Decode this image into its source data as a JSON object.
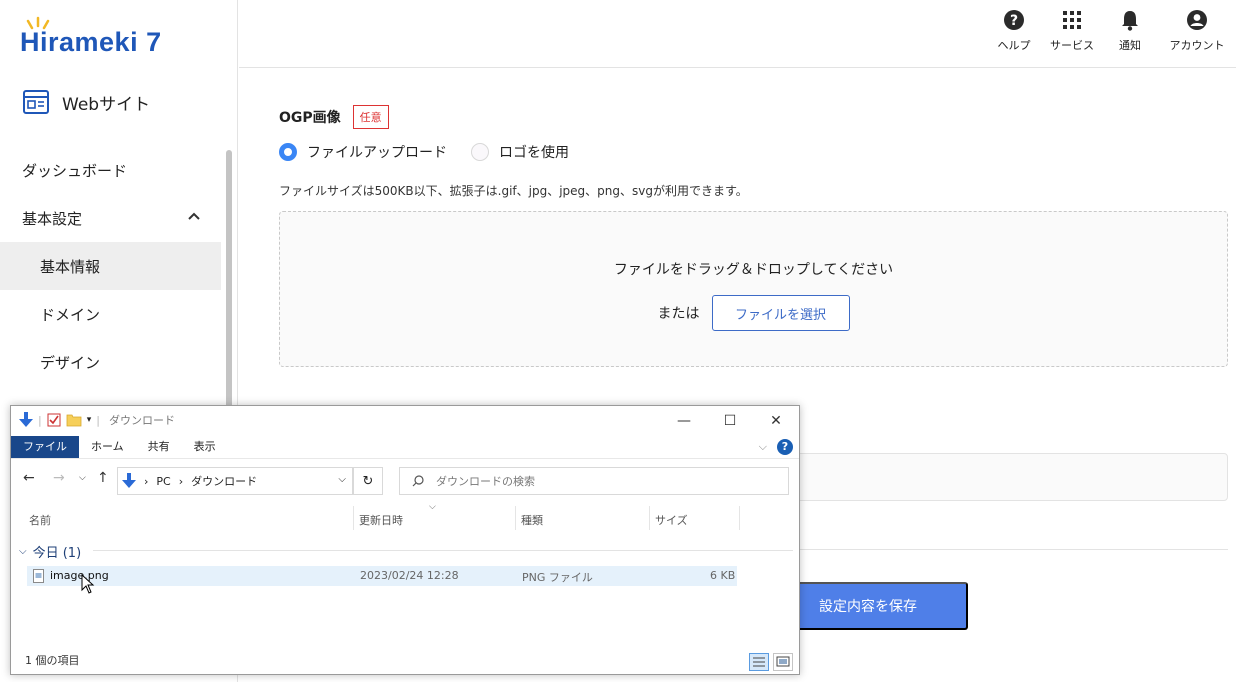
{
  "logo": {
    "text": "Hirameki 7"
  },
  "sidebar": {
    "site_label": "Webサイト",
    "items": [
      {
        "label": "ダッシュボード"
      },
      {
        "label": "基本設定"
      },
      {
        "label": "基本情報"
      },
      {
        "label": "ドメイン"
      },
      {
        "label": "デザイン"
      }
    ]
  },
  "header": {
    "actions": [
      {
        "label": "ヘルプ",
        "icon": "help-icon"
      },
      {
        "label": "サービス",
        "icon": "grid-icon"
      },
      {
        "label": "通知",
        "icon": "bell-icon"
      },
      {
        "label": "アカウント",
        "icon": "account-icon"
      }
    ]
  },
  "form": {
    "ogp_label": "OGP画像",
    "optional_badge": "任意",
    "radio_upload": "ファイルアップロード",
    "radio_logo": "ロゴを使用",
    "hint": "ファイルサイズは500KB以下、拡張子は.gif、jpg、jpeg、png、svgが利用できます。",
    "drop_text": "ファイルをドラッグ＆ドロップしてください",
    "or_text": "または",
    "choose_button": "ファイルを選択",
    "save_button": "設定内容を保存"
  },
  "explorer": {
    "title": "ダウンロード",
    "tabs": [
      "ファイル",
      "ホーム",
      "共有",
      "表示"
    ],
    "address": {
      "pc": "PC",
      "folder": "ダウンロード"
    },
    "search_placeholder": "ダウンロードの検索",
    "columns": [
      "名前",
      "更新日時",
      "種類",
      "サイズ"
    ],
    "group_label": "今日 (1)",
    "file": {
      "name": "image.png",
      "date": "2023/02/24 12:28",
      "type": "PNG ファイル",
      "size": "6 KB"
    },
    "status": "1 個の項目"
  },
  "colors": {
    "accent": "#3a86f5",
    "save_button": "#4f7fe8",
    "badge": "#dd3333",
    "logo": "#1f57b8"
  }
}
